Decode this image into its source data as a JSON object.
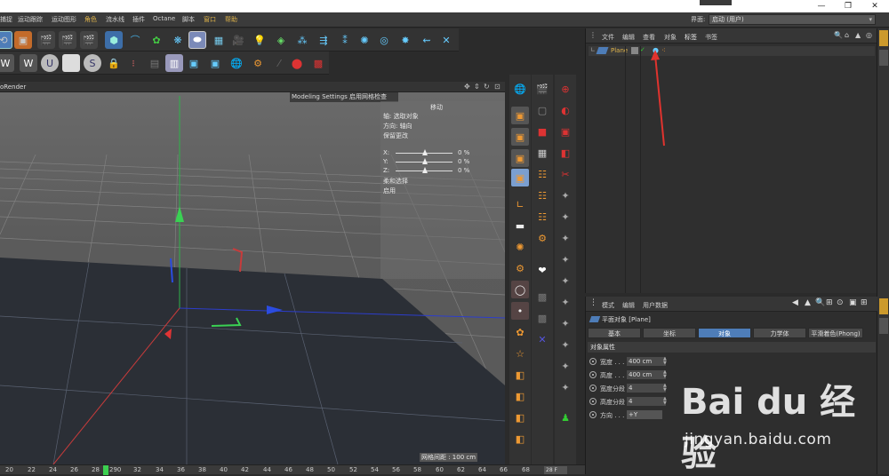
{
  "menubar": {
    "items": [
      "捕捉",
      "运动跟踪",
      "运动图形",
      "角色",
      "流水线",
      "插件",
      "Octane",
      "脚本",
      "窗口",
      "帮助"
    ],
    "layout_label": "界面:",
    "layout_value": "启动 (用户)"
  },
  "viewport": {
    "title": "oRender",
    "overlay_title": "Modeling Settings 启用网格检查",
    "tool_name": "移动",
    "lines": [
      "轴: 选取对象",
      "方向: 轴向",
      "保留更改"
    ],
    "sliders": [
      {
        "label": "X:",
        "value": "0 %"
      },
      {
        "label": "Y:",
        "value": "0 %"
      },
      {
        "label": "Z:",
        "value": "0 %"
      }
    ],
    "soft_selection": "柔和选择",
    "enable": "启用",
    "grid_readout": "网格间距 : 100 cm"
  },
  "timeline": {
    "ticks": [
      "20",
      "22",
      "24",
      "26",
      "28",
      "290",
      "32",
      "34",
      "36",
      "38",
      "40",
      "42",
      "44",
      "46",
      "48",
      "50",
      "52",
      "54",
      "56",
      "58",
      "60",
      "62",
      "64",
      "66",
      "68"
    ],
    "frame_field": "28 F"
  },
  "object_manager": {
    "menu": [
      "文件",
      "编辑",
      "查看",
      "对象",
      "标签",
      "书签"
    ],
    "objects": [
      {
        "name": "Plane"
      }
    ]
  },
  "attribute_manager": {
    "menu": [
      "模式",
      "编辑",
      "用户数据"
    ],
    "title": "平面对象 [Plane]",
    "tabs": [
      "基本",
      "坐标",
      "对象",
      "力学体",
      "平滑着色(Phong)"
    ],
    "active_tab": "对象",
    "section": "对象属性",
    "properties": [
      {
        "label": "宽度 . . .",
        "value": "400 cm"
      },
      {
        "label": "高度 . . .",
        "value": "400 cm"
      },
      {
        "label": "宽度分段",
        "value": "4"
      },
      {
        "label": "高度分段",
        "value": "4"
      },
      {
        "label": "方向 . . .",
        "value": "+Y"
      }
    ]
  },
  "watermark": {
    "brand": "Bai du 经验",
    "url": "jingyan.baidu.com"
  },
  "colors": {
    "accent": "#4e7db8",
    "highlight": "#e0b44a",
    "cursor": "#3cd050"
  }
}
